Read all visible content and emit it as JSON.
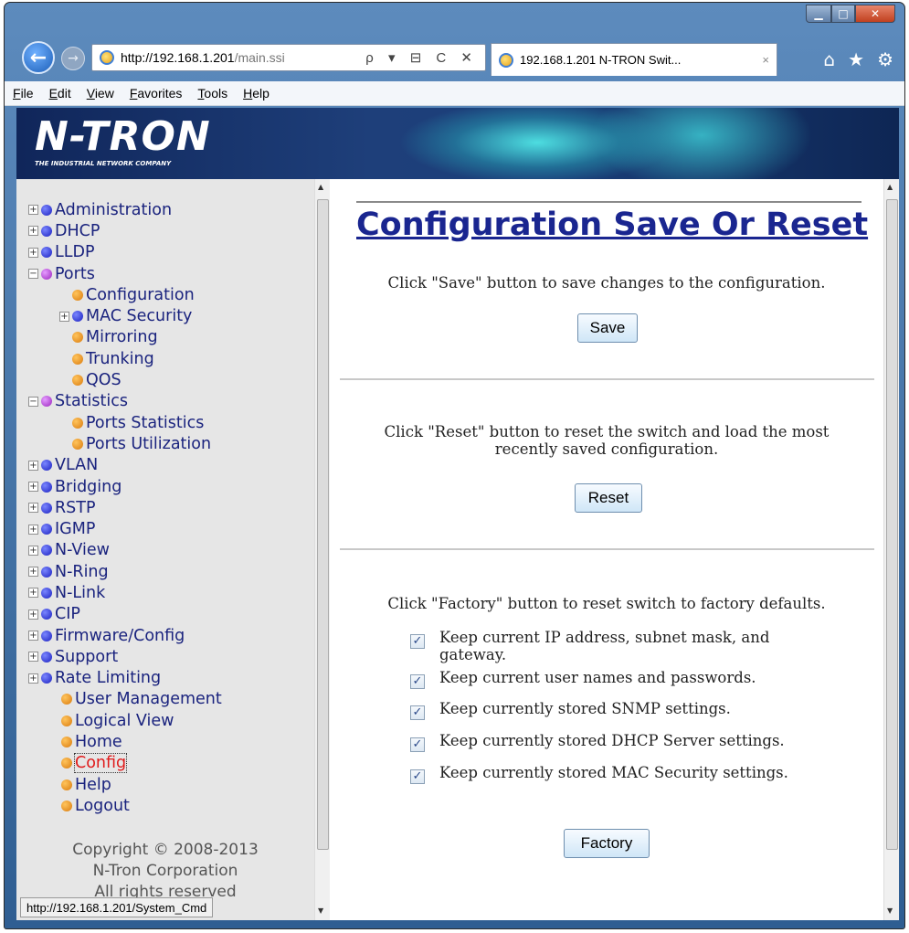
{
  "browser": {
    "url_host": "http://192.168.1.201",
    "url_path": "/main.ssi",
    "addr_tools": "ρ ▾ ⊟ C ✕",
    "tab_title": "192.168.1.201 N-TRON Swit...",
    "tab_close": "×",
    "menu": [
      "File",
      "Edit",
      "View",
      "Favorites",
      "Tools",
      "Help"
    ],
    "status_url": "http://192.168.1.201/System_Cmd",
    "window_controls": {
      "minimize": "▁",
      "maximize": "□",
      "close": "✕"
    },
    "nav_icons": {
      "back": "←",
      "forward": "→",
      "home": "⌂",
      "favorites": "★",
      "settings": "⚙"
    }
  },
  "banner": {
    "logo": "N-TRON",
    "logo_sub": "THE INDUSTRIAL NETWORK COMPANY"
  },
  "sidebar": {
    "items": [
      {
        "label": "Administration",
        "bullet": "blue",
        "expander": "+"
      },
      {
        "label": "DHCP",
        "bullet": "blue",
        "expander": "+"
      },
      {
        "label": "LLDP",
        "bullet": "blue",
        "expander": "+"
      },
      {
        "label": "Ports",
        "bullet": "purple",
        "expander": "−"
      },
      {
        "label": "Configuration",
        "bullet": "orange",
        "child": true
      },
      {
        "label": "MAC Security",
        "bullet": "blue",
        "expander": "+",
        "child": true
      },
      {
        "label": "Mirroring",
        "bullet": "orange",
        "child": true
      },
      {
        "label": "Trunking",
        "bullet": "orange",
        "child": true
      },
      {
        "label": "QOS",
        "bullet": "orange",
        "child": true
      },
      {
        "label": "Statistics",
        "bullet": "purple",
        "expander": "−"
      },
      {
        "label": "Ports Statistics",
        "bullet": "orange",
        "child": true
      },
      {
        "label": "Ports Utilization",
        "bullet": "orange",
        "child": true
      },
      {
        "label": "VLAN",
        "bullet": "blue",
        "expander": "+"
      },
      {
        "label": "Bridging",
        "bullet": "blue",
        "expander": "+"
      },
      {
        "label": "RSTP",
        "bullet": "blue",
        "expander": "+"
      },
      {
        "label": "IGMP",
        "bullet": "blue",
        "expander": "+"
      },
      {
        "label": "N-View",
        "bullet": "blue",
        "expander": "+"
      },
      {
        "label": "N-Ring",
        "bullet": "blue",
        "expander": "+"
      },
      {
        "label": "N-Link",
        "bullet": "blue",
        "expander": "+"
      },
      {
        "label": "CIP",
        "bullet": "blue",
        "expander": "+"
      },
      {
        "label": "Firmware/Config",
        "bullet": "blue",
        "expander": "+"
      },
      {
        "label": "Support",
        "bullet": "blue",
        "expander": "+"
      },
      {
        "label": "Rate Limiting",
        "bullet": "blue",
        "expander": "+"
      },
      {
        "label": "User Management",
        "bullet": "orange"
      },
      {
        "label": "Logical View",
        "bullet": "orange"
      },
      {
        "label": "Home",
        "bullet": "orange"
      },
      {
        "label": "Config",
        "bullet": "orange",
        "active": true
      },
      {
        "label": "Help",
        "bullet": "orange"
      },
      {
        "label": "Logout",
        "bullet": "orange"
      }
    ],
    "copyright": [
      "Copyright © 2008-2013",
      "N-Tron Corporation",
      "All rights reserved"
    ]
  },
  "main": {
    "title": "Configuration Save Or Reset",
    "save_text": "Click \"Save\" button to save changes to the configuration.",
    "save_button": "Save",
    "reset_text_1": "Click \"Reset\" button to reset the switch and load the most",
    "reset_text_2": "recently saved configuration.",
    "reset_button": "Reset",
    "factory_text": "Click \"Factory\" button to reset switch to factory defaults.",
    "options": [
      {
        "label": "Keep current IP address, subnet mask, and gateway.",
        "checked": true
      },
      {
        "label": "Keep current user names and passwords.",
        "checked": true
      },
      {
        "label": "Keep currently stored SNMP settings.",
        "checked": true
      },
      {
        "label": "Keep currently stored DHCP Server settings.",
        "checked": true
      },
      {
        "label": "Keep currently stored MAC Security settings.",
        "checked": true
      }
    ],
    "factory_button": "Factory"
  },
  "colors": {
    "title": "#1a2690",
    "nav_link": "#1a237e",
    "active_link": "#e01a1a",
    "sidebar_bg": "#e6e6e6"
  }
}
